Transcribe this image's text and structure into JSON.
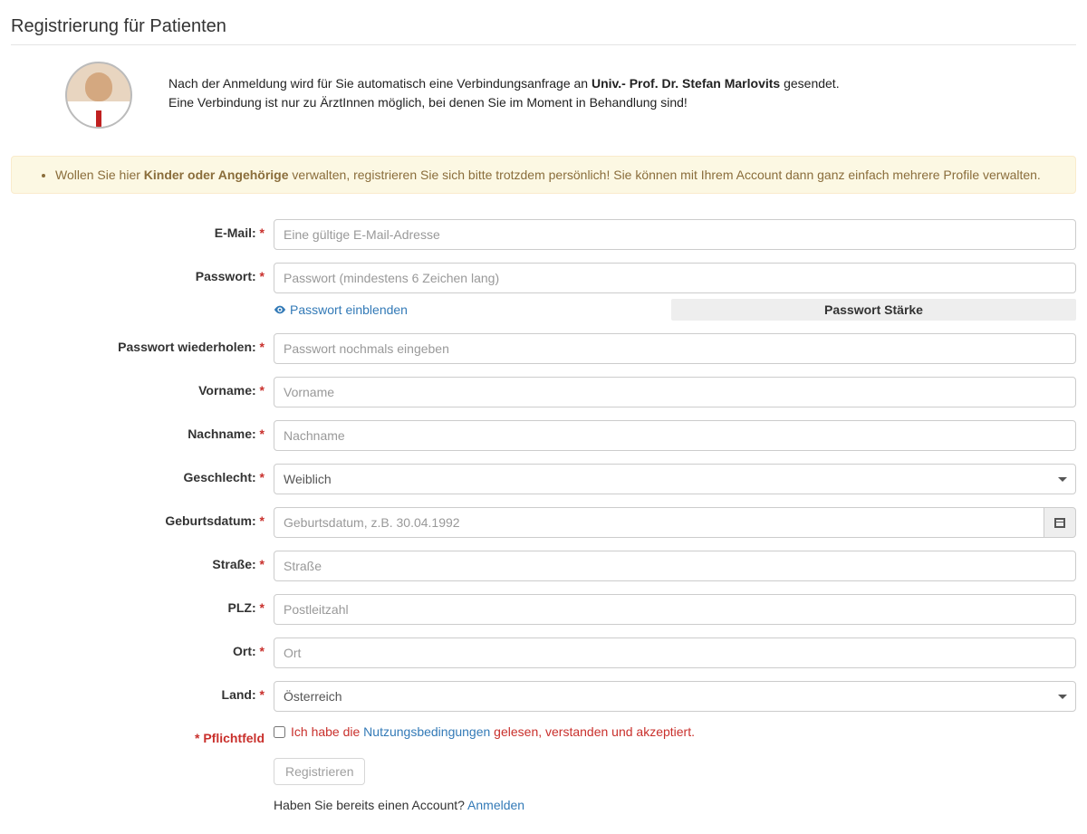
{
  "title": "Registrierung für Patienten",
  "intro": {
    "line1_pre": "Nach der Anmeldung wird für Sie automatisch eine Verbindungsanfrage an ",
    "doctor": "Univ.- Prof. Dr. Stefan Marlovits",
    "line1_post": " gesendet.",
    "line2": "Eine Verbindung ist nur zu ÄrztInnen möglich, bei denen Sie im Moment in Behandlung sind!"
  },
  "tip": {
    "pre": "Wollen Sie hier ",
    "bold": "Kinder oder Angehörige",
    "post": " verwalten, registrieren Sie sich bitte trotzdem persönlich! Sie können mit Ihrem Account dann ganz einfach mehrere Profile verwalten."
  },
  "labels": {
    "email": "E-Mail:",
    "password": "Passwort:",
    "password2": "Passwort wiederholen:",
    "firstname": "Vorname:",
    "lastname": "Nachname:",
    "gender": "Geschlecht:",
    "birthdate": "Geburtsdatum:",
    "street": "Straße:",
    "zip": "PLZ:",
    "city": "Ort:",
    "country": "Land:",
    "pflicht": "* Pflichtfeld"
  },
  "placeholders": {
    "email": "Eine gültige E-Mail-Adresse",
    "password": "Passwort (mindestens 6 Zeichen lang)",
    "password2": "Passwort nochmals eingeben",
    "firstname": "Vorname",
    "lastname": "Nachname",
    "birthdate": "Geburtsdatum, z.B. 30.04.1992",
    "street": "Straße",
    "zip": "Postleitzahl",
    "city": "Ort"
  },
  "pw": {
    "toggle": "Passwort einblenden",
    "strength": "Passwort Stärke"
  },
  "gender": {
    "selected": "Weiblich"
  },
  "country": {
    "selected": "Österreich"
  },
  "terms": {
    "pre": "Ich habe die ",
    "link": "Nutzungsbedingungen",
    "post": " gelesen, verstanden und akzeptiert."
  },
  "submit": "Registrieren",
  "login": {
    "text": "Haben Sie bereits einen Account? ",
    "link": "Anmelden"
  },
  "req": " *"
}
